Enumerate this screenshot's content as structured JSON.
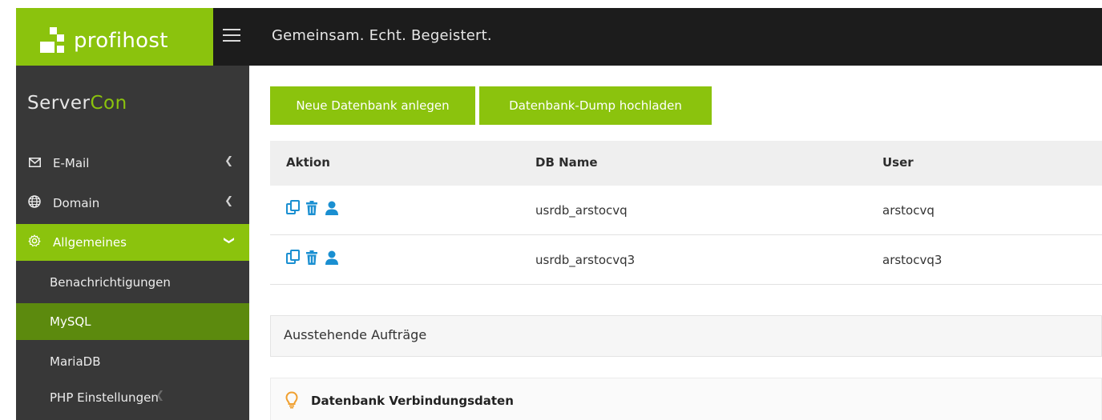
{
  "header": {
    "logo_text": "profihost",
    "slogan": "Gemeinsam. Echt. Begeistert."
  },
  "sidebar": {
    "brand_prefix": "Server",
    "brand_suffix": "Con",
    "items": [
      {
        "label": "E-Mail",
        "icon": "envelope-icon"
      },
      {
        "label": "Domain",
        "icon": "globe-icon"
      },
      {
        "label": "Allgemeines",
        "icon": "gear-icon"
      }
    ],
    "subitems": [
      {
        "label": "Benachrichtigungen"
      },
      {
        "label": "MySQL"
      },
      {
        "label": "MariaDB"
      },
      {
        "label": "PHP Einstellungen"
      }
    ]
  },
  "main": {
    "buttons": {
      "new_db": "Neue Datenbank anlegen",
      "dump_upload": "Datenbank-Dump hochladen"
    },
    "table": {
      "columns": [
        "Aktion",
        "DB Name",
        "User"
      ],
      "rows": [
        {
          "db_name": "usrdb_arstocvq",
          "user": "arstocvq"
        },
        {
          "db_name": "usrdb_arstocvq3",
          "user": "arstocvq3"
        }
      ]
    },
    "pending_title": "Ausstehende Aufträge",
    "connection_title": "Datenbank Verbindungsdaten"
  },
  "colors": {
    "accent": "#8bc30d",
    "accent_dark": "#5c8a0e",
    "topbar": "#1c1c1c",
    "sidebar": "#383838",
    "action_icon": "#1a8fd1",
    "bulb_icon": "#f0a030"
  }
}
